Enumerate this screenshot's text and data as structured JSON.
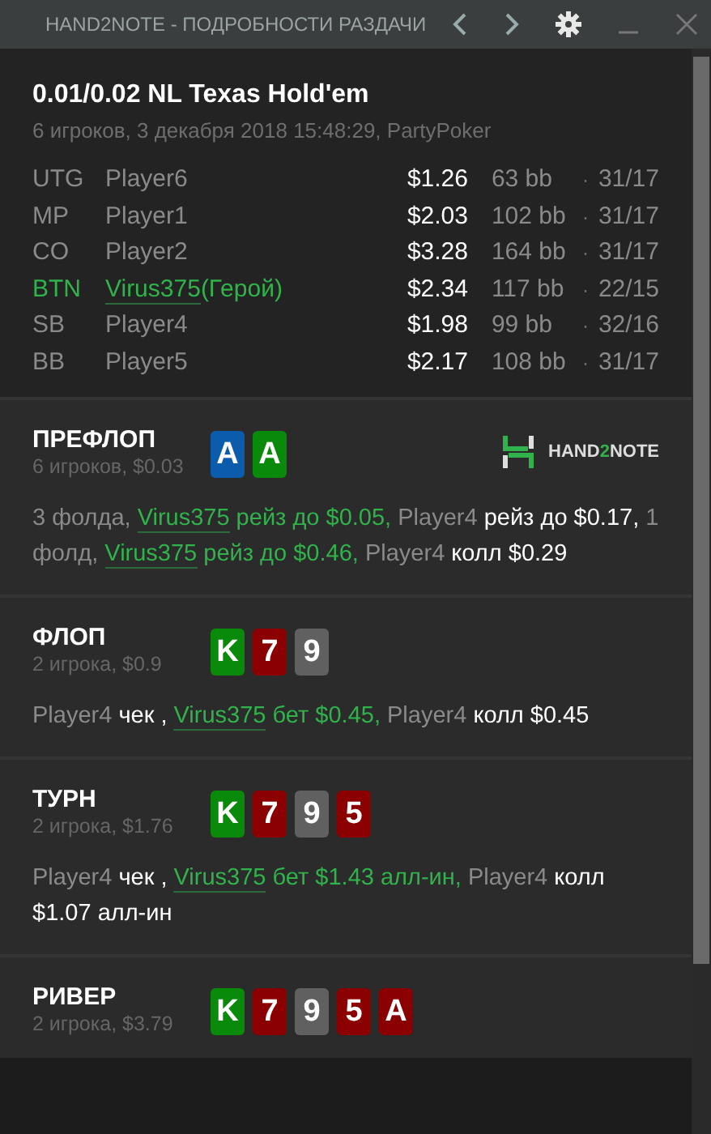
{
  "window": {
    "title": "HAND2NOTE - ПОДРОБНОСТИ РАЗДАЧИ"
  },
  "hand": {
    "title": "0.01/0.02 NL Texas Hold'em",
    "subtitle": "6 игроков, 3 декабря 2018 15:48:29, PartyPoker"
  },
  "players": [
    {
      "position": "UTG",
      "name": "Player6",
      "hero": false,
      "stack": "$1.26",
      "bb": "63 bb",
      "sep": "·",
      "stats": "31/17"
    },
    {
      "position": "MP",
      "name": "Player1",
      "hero": false,
      "stack": "$2.03",
      "bb": "102 bb",
      "sep": "·",
      "stats": "31/17"
    },
    {
      "position": "CO",
      "name": "Player2",
      "hero": false,
      "stack": "$3.28",
      "bb": "164 bb",
      "sep": "·",
      "stats": "31/17"
    },
    {
      "position": "BTN",
      "name": "Virus375",
      "hero_label": "(Герой)",
      "hero": true,
      "stack": "$2.34",
      "bb": "117 bb",
      "sep": "·",
      "stats": "22/15"
    },
    {
      "position": "SB",
      "name": "Player4",
      "hero": false,
      "stack": "$1.98",
      "bb": "99 bb",
      "sep": "·",
      "stats": "32/16"
    },
    {
      "position": "BB",
      "name": "Player5",
      "hero": false,
      "stack": "$2.17",
      "bb": "108 bb",
      "sep": "·",
      "stats": "31/17"
    }
  ],
  "streets": [
    {
      "name": "ПРЕФЛОП",
      "info": "6 игроков, $0.03",
      "logo": [
        "HAND",
        "2",
        "NOTE"
      ],
      "cards": [
        {
          "rank": "A",
          "color": "#0b5cad"
        },
        {
          "rank": "A",
          "color": "#0a8a0a"
        }
      ],
      "actions": [
        {
          "kind": "muted",
          "text": "3 фолда, "
        },
        {
          "kind": "hero-name",
          "text": "Virus375"
        },
        {
          "kind": "hero",
          "text": " рейз до $0.05, "
        },
        {
          "kind": "muted",
          "text": "Player4 "
        },
        {
          "kind": "action",
          "text": "рейз до $0.17, "
        },
        {
          "kind": "muted",
          "text": "1 фолд, "
        },
        {
          "kind": "hero-name",
          "text": "Virus375"
        },
        {
          "kind": "hero",
          "text": " рейз до $0.46, "
        },
        {
          "kind": "muted",
          "text": "Player4 "
        },
        {
          "kind": "action",
          "text": "колл $0.29"
        }
      ]
    },
    {
      "name": "ФЛОП",
      "info": "2 игрока, $0.9",
      "cards": [
        {
          "rank": "K",
          "color": "#0a8a0a"
        },
        {
          "rank": "7",
          "color": "#8b0000"
        },
        {
          "rank": "9",
          "color": "#606060"
        }
      ],
      "actions": [
        {
          "kind": "muted",
          "text": "Player4 "
        },
        {
          "kind": "action",
          "text": "чек , "
        },
        {
          "kind": "hero-name",
          "text": "Virus375"
        },
        {
          "kind": "hero",
          "text": " бет $0.45, "
        },
        {
          "kind": "muted",
          "text": "Player4 "
        },
        {
          "kind": "action",
          "text": "колл $0.45"
        }
      ]
    },
    {
      "name": "ТУРН",
      "info": "2 игрока, $1.76",
      "cards": [
        {
          "rank": "K",
          "color": "#0a8a0a"
        },
        {
          "rank": "7",
          "color": "#8b0000"
        },
        {
          "rank": "9",
          "color": "#606060"
        },
        {
          "rank": "5",
          "color": "#8b0000"
        }
      ],
      "actions": [
        {
          "kind": "muted",
          "text": "Player4 "
        },
        {
          "kind": "action",
          "text": "чек , "
        },
        {
          "kind": "hero-name",
          "text": "Virus375"
        },
        {
          "kind": "hero",
          "text": " бет $1.43 алл-ин, "
        },
        {
          "kind": "muted",
          "text": "Player4 "
        },
        {
          "kind": "action",
          "text": "колл $1.07 алл-ин"
        }
      ]
    },
    {
      "name": "РИВЕР",
      "info": "2 игрока, $3.79",
      "cards": [
        {
          "rank": "K",
          "color": "#0a8a0a"
        },
        {
          "rank": "7",
          "color": "#8b0000"
        },
        {
          "rank": "9",
          "color": "#606060"
        },
        {
          "rank": "5",
          "color": "#8b0000"
        },
        {
          "rank": "A",
          "color": "#8b0000"
        }
      ]
    }
  ]
}
